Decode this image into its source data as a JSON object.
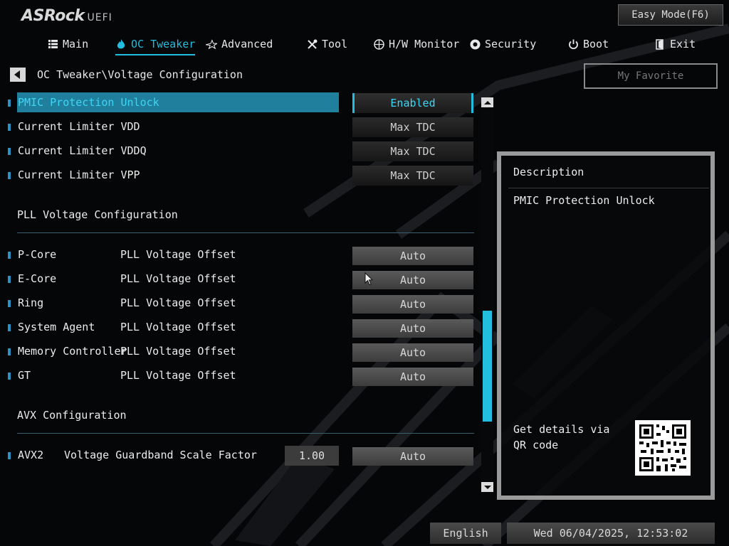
{
  "header": {
    "brand": "ASRock",
    "brand_suffix": "UEFI",
    "easy_mode_label": "Easy Mode(F6)"
  },
  "nav": {
    "items": [
      {
        "label": "Main",
        "icon": "list-icon"
      },
      {
        "label": "OC Tweaker",
        "icon": "flame-icon",
        "active": true
      },
      {
        "label": "Advanced",
        "icon": "star-icon"
      },
      {
        "label": "Tool",
        "icon": "tools-icon"
      },
      {
        "label": "H/W Monitor",
        "icon": "monitor-icon"
      },
      {
        "label": "Security",
        "icon": "shield-icon"
      },
      {
        "label": "Boot",
        "icon": "power-icon"
      },
      {
        "label": "Exit",
        "icon": "exit-icon"
      }
    ]
  },
  "breadcrumb": "OC Tweaker\\Voltage Configuration",
  "favorite_label": "My Favorite",
  "settings": {
    "top": [
      {
        "label": "PMIC Protection Unlock",
        "value": "Enabled"
      },
      {
        "label": "Current Limiter VDD",
        "value": "Max TDC"
      },
      {
        "label": "Current Limiter VDDQ",
        "value": "Max TDC"
      },
      {
        "label": "Current Limiter VPP",
        "value": "Max TDC"
      }
    ],
    "pll_section": "PLL Voltage Configuration",
    "pll": [
      {
        "label": "P-Core",
        "sub": "PLL Voltage Offset",
        "value": "Auto"
      },
      {
        "label": "E-Core",
        "sub": "PLL Voltage Offset",
        "value": "Auto"
      },
      {
        "label": "Ring",
        "sub": "PLL Voltage Offset",
        "value": "Auto"
      },
      {
        "label": "System Agent",
        "sub": "PLL Voltage Offset",
        "value": "Auto"
      },
      {
        "label": "Memory Controller",
        "sub": "PLL Voltage Offset",
        "value": "Auto"
      },
      {
        "label": "GT",
        "sub": "PLL Voltage Offset",
        "value": "Auto"
      }
    ],
    "avx_section": "AVX Configuration",
    "avx": {
      "label": "AVX2",
      "sub": "Voltage Guardband Scale Factor",
      "input": "1.00",
      "value": "Auto"
    }
  },
  "description": {
    "title": "Description",
    "text": "PMIC Protection Unlock",
    "qr_text": "Get details via QR code"
  },
  "footer": {
    "language": "English",
    "datetime": "Wed 06/04/2025, 12:53:02"
  },
  "colors": {
    "accent": "#23bde0",
    "selected_row": "#1f7f9d"
  }
}
